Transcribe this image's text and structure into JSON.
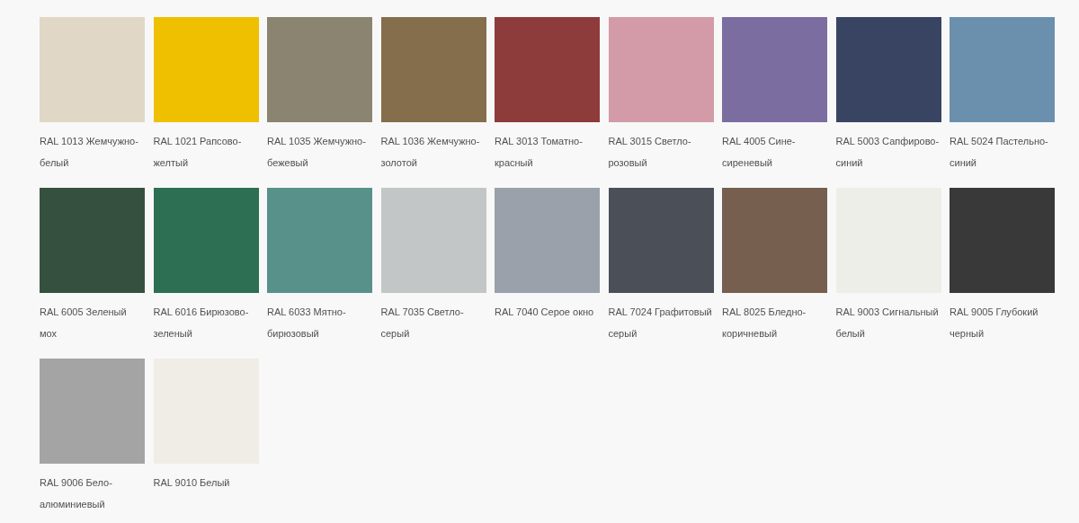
{
  "swatches": [
    {
      "label": "RAL 1013 Жемчужно-белый",
      "color": "#e0d7c6"
    },
    {
      "label": "RAL 1021 Рапсово-желтый",
      "color": "#efc000"
    },
    {
      "label": "RAL 1035 Жемчужно-бежевый",
      "color": "#8a8470"
    },
    {
      "label": "RAL 1036 Жемчужно-золотой",
      "color": "#856e4b"
    },
    {
      "label": "RAL 3013 Томатно-красный",
      "color": "#8e3b3c"
    },
    {
      "label": "RAL 3015 Светло-розовый",
      "color": "#d39ba8"
    },
    {
      "label": "RAL 4005 Сине-сиреневый",
      "color": "#7c6da1"
    },
    {
      "label": "RAL 5003 Сапфирово-синий",
      "color": "#384462"
    },
    {
      "label": "RAL 5024 Пастельно-синий",
      "color": "#6b90ae"
    },
    {
      "label": "RAL 6005 Зеленый мох",
      "color": "#36503f"
    },
    {
      "label": "RAL 6016 Бирюзово-зеленый",
      "color": "#2c6f52"
    },
    {
      "label": "RAL 6033 Мятно-бирюзовый",
      "color": "#58918a"
    },
    {
      "label": "RAL 7035 Светло-серый",
      "color": "#c2c6c7"
    },
    {
      "label": "RAL 7040 Серое окно",
      "color": "#9aa1aa"
    },
    {
      "label": "RAL 7024 Графитовый серый",
      "color": "#4b4f57"
    },
    {
      "label": "RAL 8025 Бледно-коричневый",
      "color": "#765f4f"
    },
    {
      "label": "RAL 9003 Сигнальный белый",
      "color": "#eeeee9"
    },
    {
      "label": "RAL 9005 Глубокий черный",
      "color": "#393939"
    },
    {
      "label": "RAL 9006 Бело-алюминиевый",
      "color": "#a4a4a4"
    },
    {
      "label": "RAL 9010 Белый",
      "color": "#f0ede6"
    }
  ]
}
